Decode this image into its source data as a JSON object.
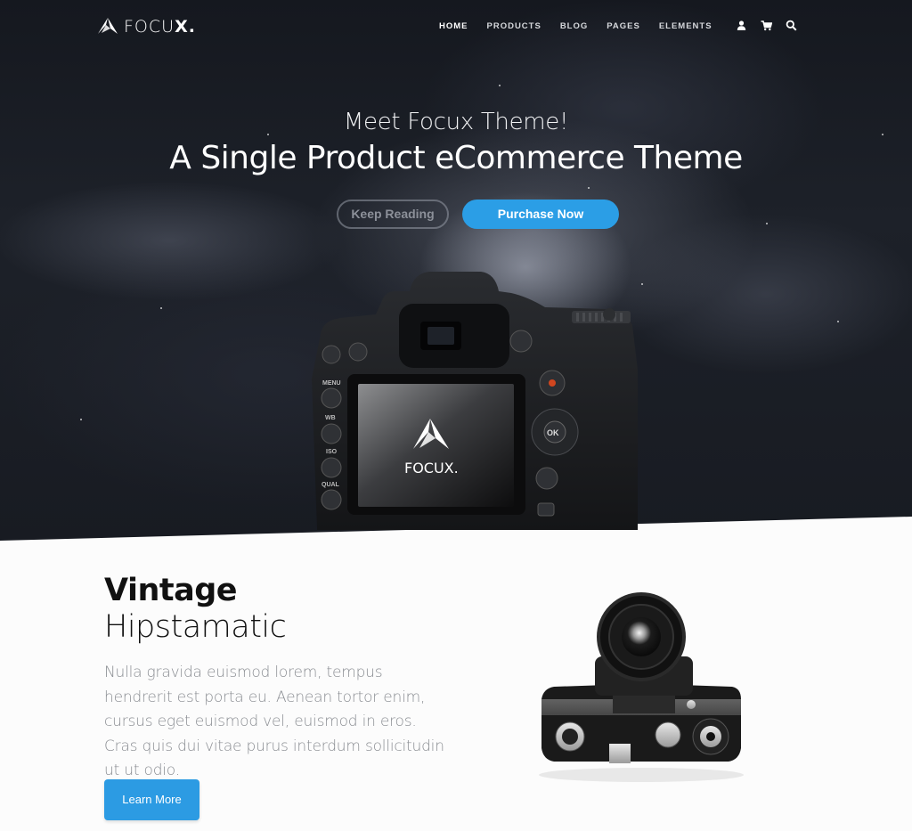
{
  "brand": {
    "name_light": "FOCU",
    "name_bold": "X."
  },
  "nav": {
    "items": [
      {
        "label": "HOME",
        "active": true
      },
      {
        "label": "PRODUCTS",
        "active": false
      },
      {
        "label": "BLOG",
        "active": false
      },
      {
        "label": "PAGES",
        "active": false
      },
      {
        "label": "ELEMENTS",
        "active": false
      }
    ],
    "icons": [
      "user-icon",
      "cart-icon",
      "search-icon"
    ]
  },
  "hero": {
    "subtitle": "Meet Focux Theme!",
    "title": "A Single Product eCommerce Theme",
    "secondary_button": "Keep Reading",
    "primary_button": "Purchase Now",
    "screen_logo": "FOCUX."
  },
  "feature": {
    "heading_bold": "Vintage",
    "heading_light": "Hipstamatic",
    "body": "Nulla gravida euismod lorem, tempus hendrerit est porta eu. Aenean tortor enim, cursus eget euismod vel, euismod in eros. Cras quis dui vitae purus interdum sollicitudin ut ut odio.",
    "button": "Learn More"
  },
  "colors": {
    "accent": "#2b9ee6",
    "hero_bg": "#1a1d24",
    "page_bg": "#fcfcfc"
  }
}
